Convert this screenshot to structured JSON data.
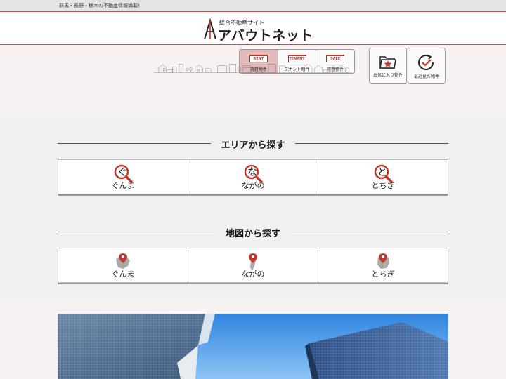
{
  "topbar": {
    "tagline": "群馬・長野・栃木の不動産情報満載！"
  },
  "logo": {
    "subtitle": "総合不動産サイト",
    "name": "アバウトネット"
  },
  "property_tabs": [
    {
      "badge": "RENT",
      "label": "賃貸物件",
      "active": true
    },
    {
      "badge": "TENANT",
      "label": "テナント物件",
      "active": false
    },
    {
      "badge": "SALE",
      "label": "売買物件",
      "active": false
    }
  ],
  "quick_links": {
    "favorites": {
      "label": "お気に入り物件",
      "icon": "favorites-folder-icon"
    },
    "recent": {
      "label": "最近見た物件",
      "icon": "clock-check-icon"
    }
  },
  "area_search": {
    "title": "エリアから探す",
    "items": [
      {
        "label": "ぐんま",
        "glyph": "ぐ",
        "icon": "magnifier-icon"
      },
      {
        "label": "ながの",
        "glyph": "な",
        "icon": "magnifier-icon"
      },
      {
        "label": "とちぎ",
        "glyph": "と",
        "icon": "magnifier-icon"
      }
    ]
  },
  "map_search": {
    "title": "地図から探す",
    "items": [
      {
        "label": "ぐんま",
        "icon": "map-pin-icon"
      },
      {
        "label": "ながの",
        "icon": "map-pin-icon"
      },
      {
        "label": "とちぎ",
        "icon": "map-pin-icon"
      }
    ]
  },
  "colors": {
    "accent": "#c0392b",
    "header_rule": "#c94a4a",
    "hero_bg": "#f8f1f1",
    "page_bg": "#f0f0f0"
  }
}
